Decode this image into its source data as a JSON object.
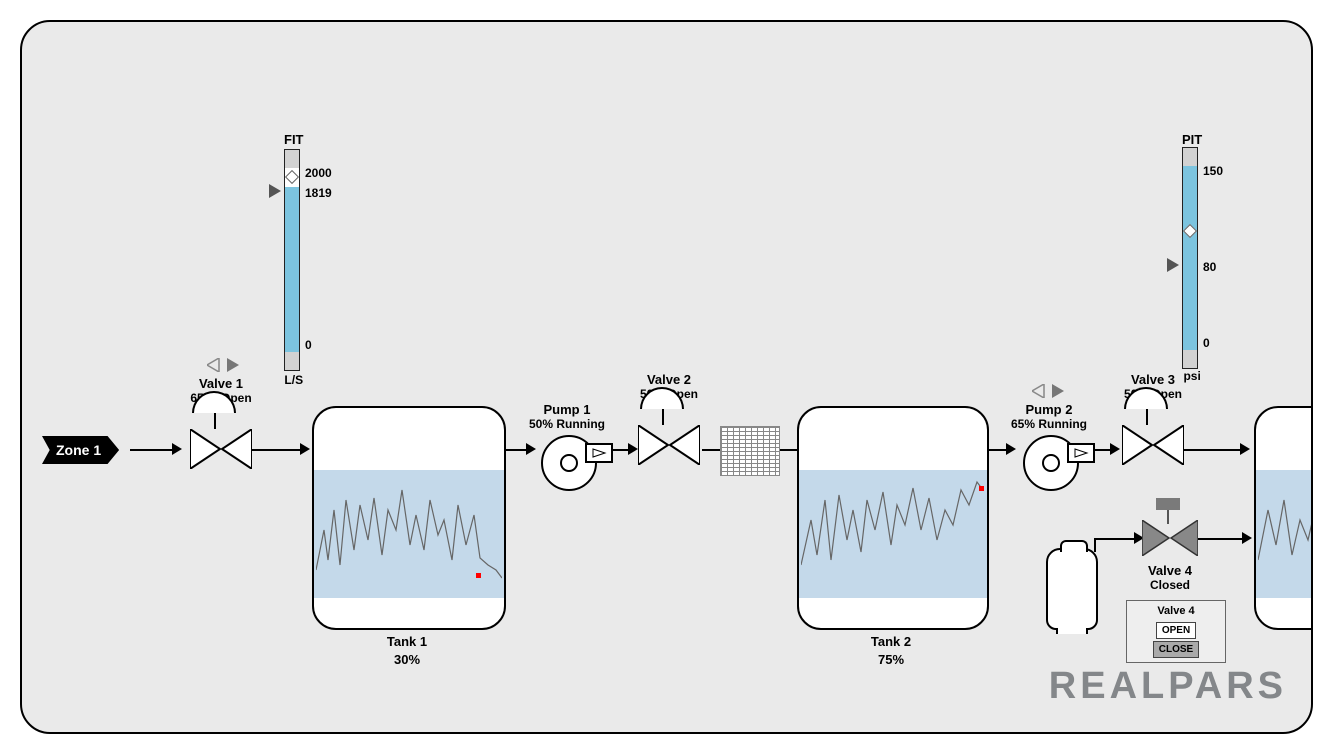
{
  "zone": {
    "label": "Zone 1"
  },
  "fit": {
    "title": "FIT",
    "unit": "L/S",
    "max": "2000",
    "min": "0",
    "value": "1819",
    "fill_pct": 90
  },
  "pit": {
    "title": "PIT",
    "unit": "psi",
    "max": "150",
    "min": "0",
    "value": "80",
    "fill_pct": 100,
    "marker_pct": 53
  },
  "valve1": {
    "name": "Valve 1",
    "status": "65 % Open"
  },
  "valve2": {
    "name": "Valve 2",
    "status": "50% Open"
  },
  "valve3": {
    "name": "Valve 3",
    "status": "50% Open"
  },
  "valve4": {
    "name": "Valve 4",
    "status": "Closed",
    "panel_title": "Valve 4",
    "btn_open": "OPEN",
    "btn_close": "CLOSE"
  },
  "pump1": {
    "name": "Pump 1",
    "status": "50% Running"
  },
  "pump2": {
    "name": "Pump 2",
    "status": "65% Running"
  },
  "tank1": {
    "name": "Tank 1",
    "level": "30%"
  },
  "tank2": {
    "name": "Tank 2",
    "level": "75%"
  },
  "nav_arrows": {
    "left_enabled": false,
    "right_enabled": true
  },
  "brand": "REALPARS"
}
